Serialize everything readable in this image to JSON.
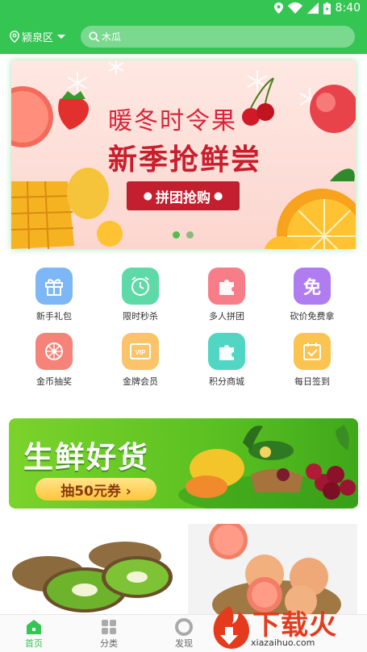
{
  "status_bar": {
    "time": "8:40"
  },
  "header": {
    "location": "颍泉区",
    "search_text": "木瓜"
  },
  "banner": {
    "title_line1": "暖冬时令果",
    "title_line2": "新季抢鲜尝",
    "cta": "拼团抢购",
    "active_dot": 0,
    "dot_count": 2
  },
  "grid": {
    "items": [
      {
        "label": "新手礼包",
        "icon": "gift-icon",
        "color": "#7db7f5"
      },
      {
        "label": "限时秒杀",
        "icon": "alarm-clock-icon",
        "color": "#5ddaa7"
      },
      {
        "label": "多人拼团",
        "icon": "puzzle-icon",
        "color": "#f77e88"
      },
      {
        "label": "砍价免费拿",
        "icon": "free-badge-icon",
        "color": "#b07df0"
      },
      {
        "label": "金币抽奖",
        "icon": "lottery-wheel-icon",
        "color": "#f5837a"
      },
      {
        "label": "金牌会员",
        "icon": "vip-card-icon",
        "color": "#fbc46b"
      },
      {
        "label": "积分商城",
        "icon": "puzzle-store-icon",
        "color": "#52d6c4"
      },
      {
        "label": "每日签到",
        "icon": "calendar-check-icon",
        "color": "#fbc34f"
      }
    ]
  },
  "promo": {
    "title": "生鲜好货",
    "button": "抽50元券 ›"
  },
  "bottom_nav": {
    "tabs": [
      {
        "label": "首页",
        "icon": "home-icon",
        "active": true
      },
      {
        "label": "分类",
        "icon": "grid-icon",
        "active": false
      },
      {
        "label": "发现",
        "icon": "discover-icon",
        "active": false
      }
    ]
  },
  "watermark": {
    "title": "下载火",
    "url": "xiazaihuo.com"
  },
  "colors": {
    "brand_green": "#35c553",
    "banner_red": "#c91e2e"
  }
}
